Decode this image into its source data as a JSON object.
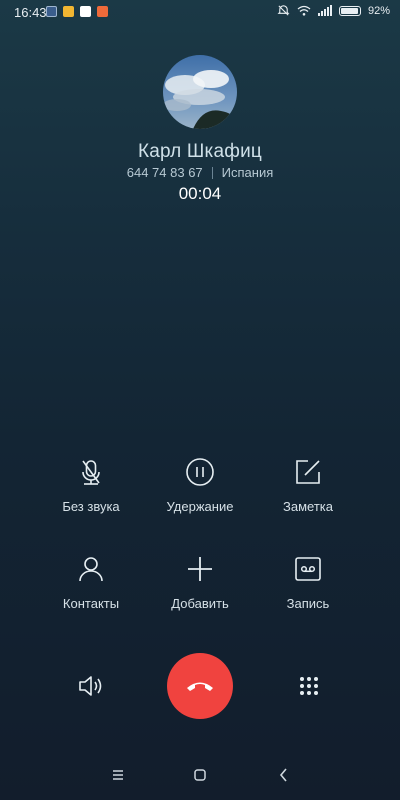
{
  "status_bar": {
    "time": "16:43",
    "battery_percent": "92%",
    "battery_level": 0.92,
    "notification_icons": [
      "message-icon",
      "bookmark-icon",
      "gmail-icon",
      "app-icon"
    ]
  },
  "contact": {
    "name": "Карл Шкафиц",
    "number": "644 74 83 67",
    "location": "Испания",
    "duration": "00:04"
  },
  "controls": {
    "mute": "Без звука",
    "hold": "Удержание",
    "note": "Заметка",
    "contacts": "Контакты",
    "add": "Добавить",
    "record": "Запись"
  },
  "bottom": {
    "speaker_icon": "speaker-icon",
    "end_call_icon": "phone-hangup-icon",
    "dialpad_icon": "dialpad-icon"
  },
  "nav": {
    "icons": [
      "menu-icon",
      "home-icon",
      "back-icon"
    ]
  },
  "colors": {
    "end_call": "#f0433f",
    "background_top": "#1b3946",
    "background_bottom": "#121d2c"
  }
}
